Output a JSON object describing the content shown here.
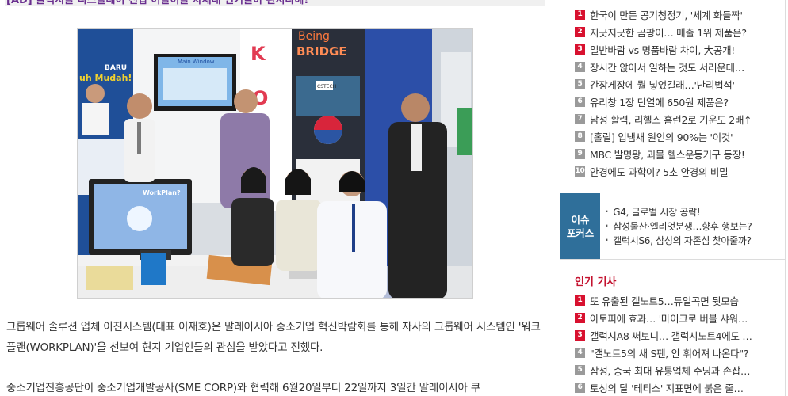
{
  "article": {
    "ad_line": "[AD] 클릭시를 디스플레이 진입 어플이를 차세대 인기들이 된지나해!",
    "paragraph_1": "그룹웨어 솔루션 업체 이진시스템(대표 이재호)은 말레이시아 중소기업 혁신박람회를 통해 자사의 그룹웨어 시스템인 '워크플랜(WORKPLAN)'을 선보여 현지 기업인들의 관심을 받았다고 전했다.",
    "paragraph_2": "중소기업진흥공단이 중소기업개발공사(SME CORP)와 협력해 6월20일부터 22일까지 3일간 말레이시아 쿠",
    "photo": {
      "monitor_top_text": "Main Window",
      "monitor_laptop_text": "WorkPlan?",
      "banner_left_text_1": "BARU",
      "banner_left_text_2": "uh Mudah!",
      "banner_right_title_1": "Being",
      "banner_right_title_2": "BRIDGE",
      "banner_right_logo": "CSTECH",
      "letter_k": "K",
      "letter_o": "O"
    }
  },
  "sidebar": {
    "ranking": [
      {
        "num": "1",
        "text": "한국이 만든 공기청정기, '세계 화들짝'",
        "hot": true
      },
      {
        "num": "2",
        "text": "지긋지긋한 곰팡이… 매출 1위 제품은?",
        "hot": true
      },
      {
        "num": "3",
        "text": "일반바람 vs 명품바람 차이, 大공개!",
        "hot": true
      },
      {
        "num": "4",
        "text": "장시간 앉아서 일하는 것도 서러운데…",
        "hot": false
      },
      {
        "num": "5",
        "text": "간장게장에 뭘 넣었길래…'난리법석'",
        "hot": false
      },
      {
        "num": "6",
        "text": "유리창 1장 단열에 650원 제품은?",
        "hot": false
      },
      {
        "num": "7",
        "text": "남성 활력, 리헬스 홈런2로 기운도 2배↑",
        "hot": false
      },
      {
        "num": "8",
        "text": "[홀릴] 입냄새 원인의 90%는 '이것'",
        "hot": false
      },
      {
        "num": "9",
        "text": "MBC 발명왕, 괴물 헬스운동기구 등장!",
        "hot": false
      },
      {
        "num": "10",
        "text": "안경에도 과학이? 5초 안경의 비밀",
        "hot": false
      }
    ],
    "issue": {
      "tag_line_1": "이슈",
      "tag_line_2": "포커스",
      "items": [
        "G4, 글로벌 시장 공략!",
        "삼성물산·엘리엇분쟁…향후 행보는?",
        "갤럭시S6, 삼성의 자존심 찾아줄까?"
      ]
    },
    "popular": {
      "title": "인기 기사",
      "items": [
        {
          "num": "1",
          "text": "또 유출된 갤노트5…듀얼곡면 뒷모습",
          "hot": true
        },
        {
          "num": "2",
          "text": "아토피에 효과… '마이크로 버블 샤워…",
          "hot": true
        },
        {
          "num": "3",
          "text": "갤럭시A8 써보니… 갤럭시노트4에도 …",
          "hot": true
        },
        {
          "num": "4",
          "text": "\"갤노트5의 새 S펜, 안 휘어져 나온다\"?",
          "hot": false
        },
        {
          "num": "5",
          "text": "삼성, 중국 최대 유통업체 수닝과 손잡…",
          "hot": false
        },
        {
          "num": "6",
          "text": "토성의 달 '테티스' 지표면에 붉은 줄…",
          "hot": false
        }
      ]
    }
  },
  "colors": {
    "hot_badge": "#d8112f",
    "cold_badge": "#9a9a9a",
    "issue_tag": "#2f6f9a",
    "popular_title": "#c4122f",
    "ad_text": "#6a2f8f"
  }
}
